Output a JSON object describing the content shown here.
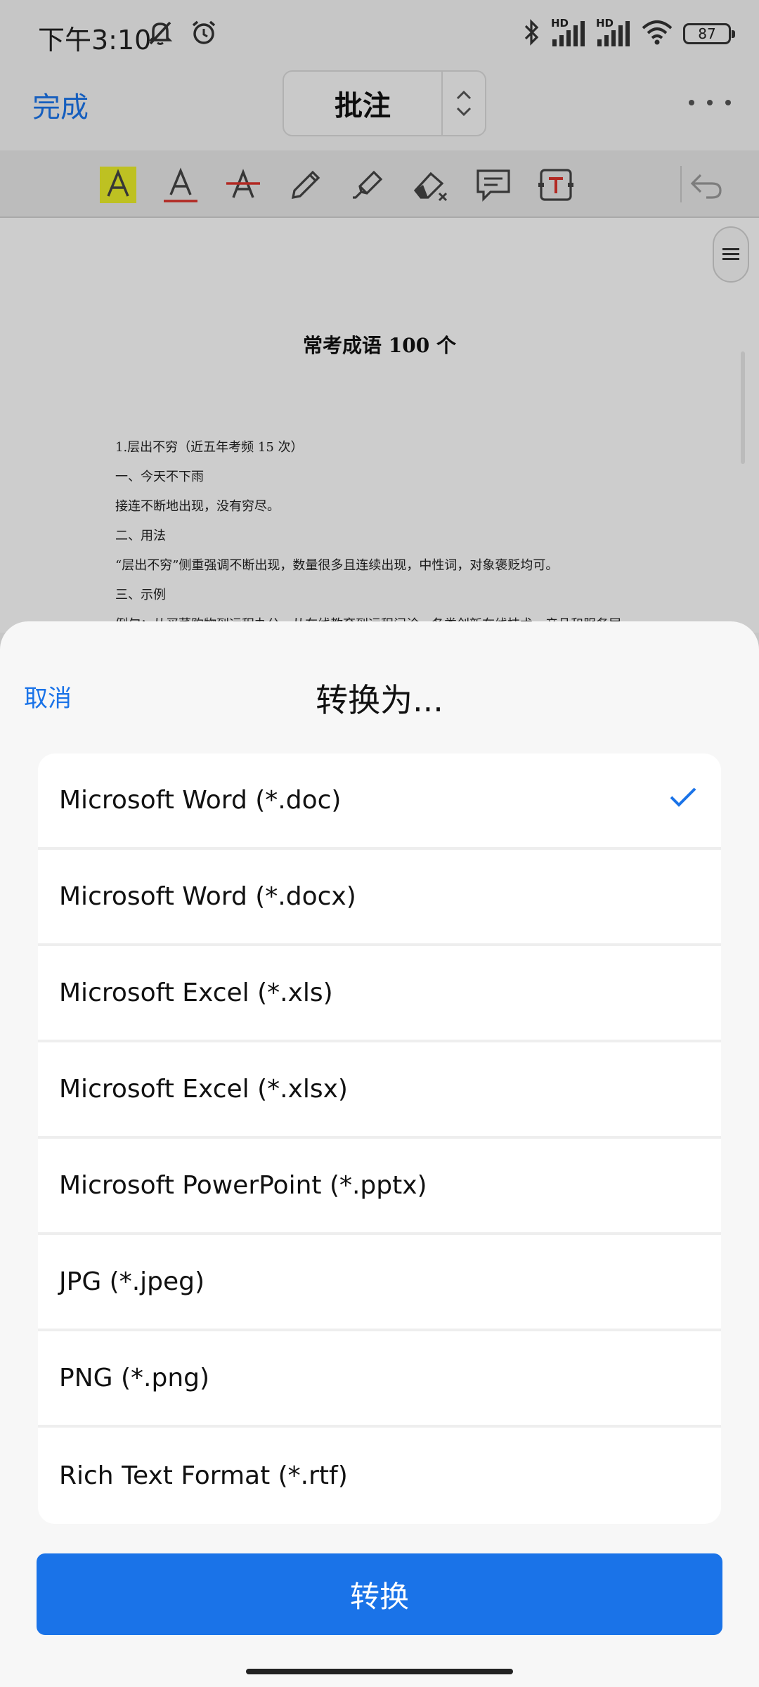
{
  "status": {
    "time": "下午3:10",
    "battery": "87",
    "signal_badge": "HD"
  },
  "header": {
    "done_label": "完成",
    "mode_label": "批注"
  },
  "document": {
    "title": "常考成语 100 个",
    "lines": [
      "1.层出不穷（近五年考频 15 次）",
      "一、今天不下雨",
      "接连不断地出现，没有穷尽。",
      "二、用法",
      "“层出不穷”侧重强调不断出现，数量很多且连续出现，中性词，对象褒贬均可。",
      "三、示例",
      "例句：从买菜购物到远程办公，从在线教育到远程问诊，各类创新在线技术、产品和服务层"
    ]
  },
  "sheet": {
    "cancel_label": "取消",
    "title": "转换为...",
    "formats": [
      "Microsoft Word (*.doc)",
      "Microsoft Word (*.docx)",
      "Microsoft Excel (*.xls)",
      "Microsoft Excel (*.xlsx)",
      "Microsoft PowerPoint (*.pptx)",
      "JPG (*.jpeg)",
      "PNG (*.png)",
      "Rich Text Format (*.rtf)"
    ],
    "selected_format": "Microsoft Word (*.doc)",
    "convert_label": "转换"
  },
  "colors": {
    "accent": "#1a73e8",
    "highlight": "#e8ec2a",
    "red_tool": "#d9322b"
  },
  "icons": {
    "toolbar": [
      "highlight-text-icon",
      "underline-text-icon",
      "strikethrough-text-icon",
      "pencil-icon",
      "marker-icon",
      "eraser-icon",
      "comment-icon",
      "text-box-icon",
      "undo-icon"
    ],
    "status": [
      "mute-icon",
      "alarm-icon",
      "bluetooth-icon",
      "signal-icon",
      "wifi-icon",
      "battery-icon"
    ]
  }
}
